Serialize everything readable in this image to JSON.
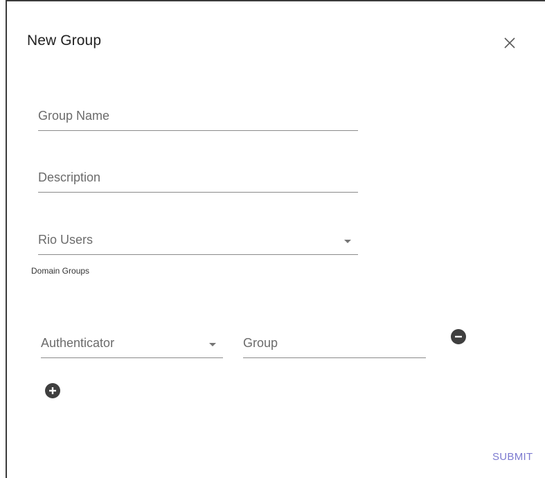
{
  "dialog": {
    "title": "New Group",
    "close_icon": "close-icon"
  },
  "form": {
    "group_name": {
      "placeholder": "Group Name",
      "value": ""
    },
    "description": {
      "placeholder": "Description",
      "value": ""
    },
    "users_select": {
      "label": "Rio Users",
      "icon": "chevron-down-icon"
    }
  },
  "domain_groups": {
    "section_label": "Domain Groups",
    "rows": [
      {
        "authenticator_label": "Authenticator",
        "group_placeholder": "Group",
        "remove_icon": "minus-circle-icon"
      }
    ],
    "add_icon": "plus-circle-icon"
  },
  "footer": {
    "submit_label": "SUBMIT"
  },
  "colors": {
    "accent": "#7c7ad0",
    "icon_fill": "#3f3f3f",
    "underline": "#8a8a8a"
  }
}
